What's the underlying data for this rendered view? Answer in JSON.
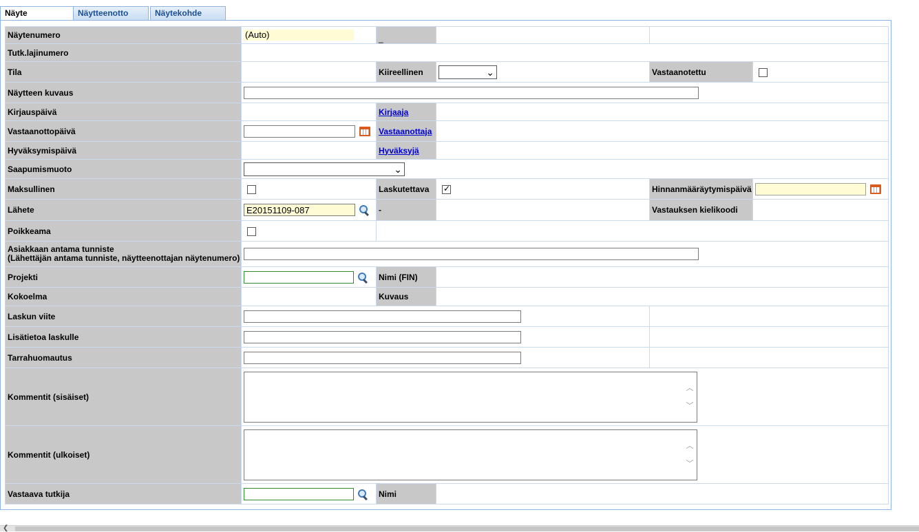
{
  "tabs": [
    {
      "label": "Näyte",
      "active": true
    },
    {
      "label": "Näytteenotto",
      "active": false
    },
    {
      "label": "Näytekohde",
      "active": false
    }
  ],
  "form": {
    "naytenumero": {
      "label": "Näytenumero",
      "value": "(Auto)",
      "extra": "_"
    },
    "tutk_lajinumero": {
      "label": "Tutk.lajinumero"
    },
    "tila": {
      "label": "Tila"
    },
    "kiireellinen": {
      "label": "Kiireellinen",
      "value": ""
    },
    "vastaanotettu": {
      "label": "Vastaanotettu",
      "checked": false
    },
    "kuvaus": {
      "label": "Näytteen kuvaus",
      "value": ""
    },
    "kirjauspaiva": {
      "label": "Kirjauspäivä"
    },
    "kirjaaja": {
      "label": "Kirjaaja"
    },
    "vastaanottopaiva": {
      "label": "Vastaanottopäivä",
      "value": ""
    },
    "vastaanottaja": {
      "label": "Vastaanottaja"
    },
    "hyvaksymispaiva": {
      "label": "Hyväksymispäivä"
    },
    "hyvaksyja": {
      "label": "Hyväksyjä"
    },
    "saapumismuoto": {
      "label": "Saapumismuoto",
      "value": ""
    },
    "maksullinen": {
      "label": "Maksullinen",
      "checked": false
    },
    "laskutettava": {
      "label": "Laskutettava",
      "checked": true
    },
    "hinnanmaaraytymispaiva": {
      "label": "Hinnanmääräytymispäivä",
      "value": ""
    },
    "lahete": {
      "label": "Lähete",
      "value": "E20151109-087",
      "extra": "-"
    },
    "kielikoodi": {
      "label": "Vastauksen kielikoodi"
    },
    "poikkeama": {
      "label": "Poikkeama",
      "checked": false
    },
    "asiakas_tunniste": {
      "label_line1": "Asiakkaan antama tunniste",
      "label_line2": "(Lähettäjän antama tunniste, näytteenottajan näytenumero)",
      "value": ""
    },
    "projekti": {
      "label": "Projekti",
      "value": ""
    },
    "nimi_fin": {
      "label": "Nimi (FIN)"
    },
    "kokoelma": {
      "label": "Kokoelma"
    },
    "kuvaus2": {
      "label": "Kuvaus"
    },
    "laskun_viite": {
      "label": "Laskun viite",
      "value": ""
    },
    "lisatietoa": {
      "label": "Lisätietoa laskulle",
      "value": ""
    },
    "tarrahuomautus": {
      "label": "Tarrahuomautus",
      "value": ""
    },
    "kommentit_sis": {
      "label": "Kommentit (sisäiset)",
      "value": ""
    },
    "kommentit_ulk": {
      "label": "Kommentit (ulkoiset)",
      "value": ""
    },
    "vastaava_tutkija": {
      "label": "Vastaava tutkija",
      "value": ""
    },
    "nimi": {
      "label": "Nimi"
    }
  }
}
